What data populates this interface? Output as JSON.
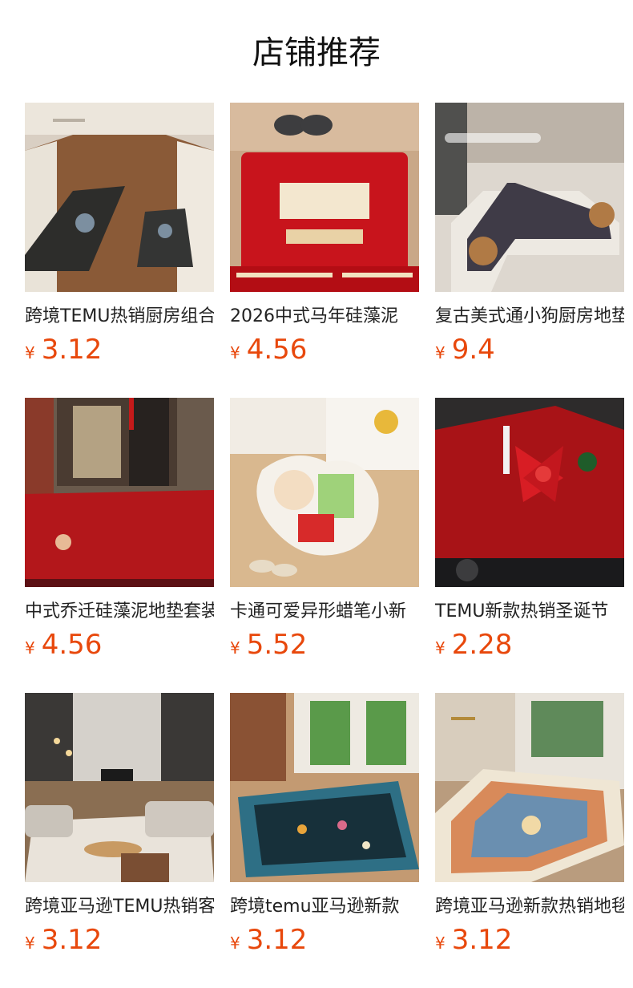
{
  "page": {
    "title": "店铺推荐"
  },
  "currency": "¥",
  "colors": {
    "price": "#e8480c",
    "title": "#111111",
    "name": "#222222"
  },
  "products": [
    {
      "name": "跨境TEMU热销厨房组合",
      "price": "3.12",
      "image": "kitchen-coffee-mat-image"
    },
    {
      "name": "2026中式马年硅藻泥",
      "price": "4.56",
      "image": "new-year-red-mat-image"
    },
    {
      "name": "复古美式通小狗厨房地垫",
      "price": "9.4",
      "image": "cartoon-dog-kitchen-mat-image"
    },
    {
      "name": "中式乔迁硅藻泥地垫套装",
      "price": "4.56",
      "image": "red-chinese-door-mat-image"
    },
    {
      "name": "卡通可爱异形蜡笔小新",
      "price": "5.52",
      "image": "cartoon-shaped-rug-image"
    },
    {
      "name": "TEMU新款热销圣诞节",
      "price": "2.28",
      "image": "christmas-washer-cover-image"
    },
    {
      "name": "跨境亚马逊TEMU热销客厅",
      "price": "3.12",
      "image": "living-room-rug-image"
    },
    {
      "name": "跨境temu亚马逊新款",
      "price": "3.12",
      "image": "blue-floral-rug-image"
    },
    {
      "name": "跨境亚马逊新款热销地毯",
      "price": "3.12",
      "image": "bohemian-entry-rug-image"
    }
  ]
}
